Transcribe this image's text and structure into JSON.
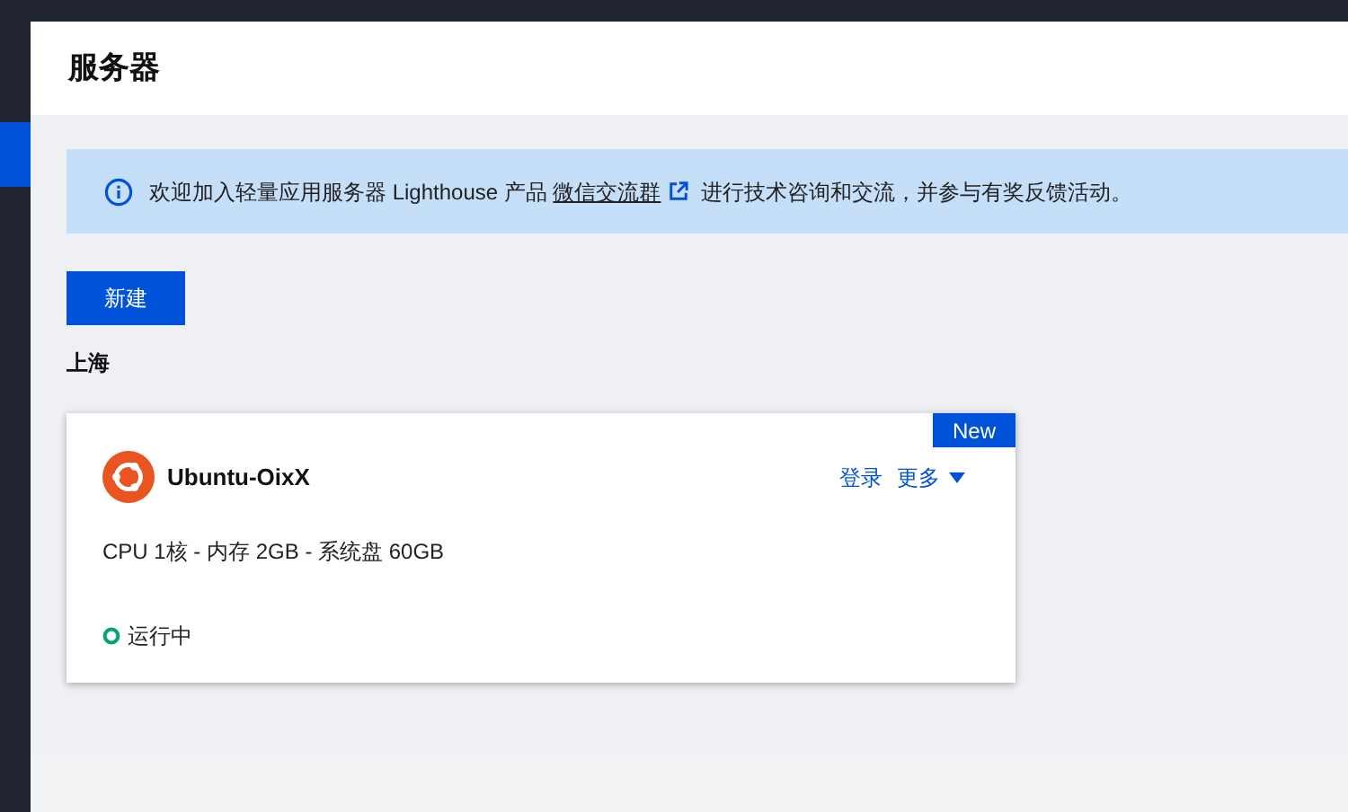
{
  "page": {
    "title": "服务器"
  },
  "sidebar": {
    "items": [
      {
        "selected": true
      }
    ]
  },
  "notice": {
    "before": "欢迎加入轻量应用服务器 Lighthouse 产品 ",
    "link": "微信交流群",
    "after": " 进行技术咨询和交流，并参与有奖反馈活动。"
  },
  "create_button": "新建",
  "region": "上海",
  "instances": [
    {
      "badge": "New",
      "name": "Ubuntu-OixX",
      "actions": [
        "登录",
        "更多"
      ],
      "specs": "CPU 1核 - 内存 2GB - 系统盘 60GB",
      "status": "运行中"
    }
  ]
}
